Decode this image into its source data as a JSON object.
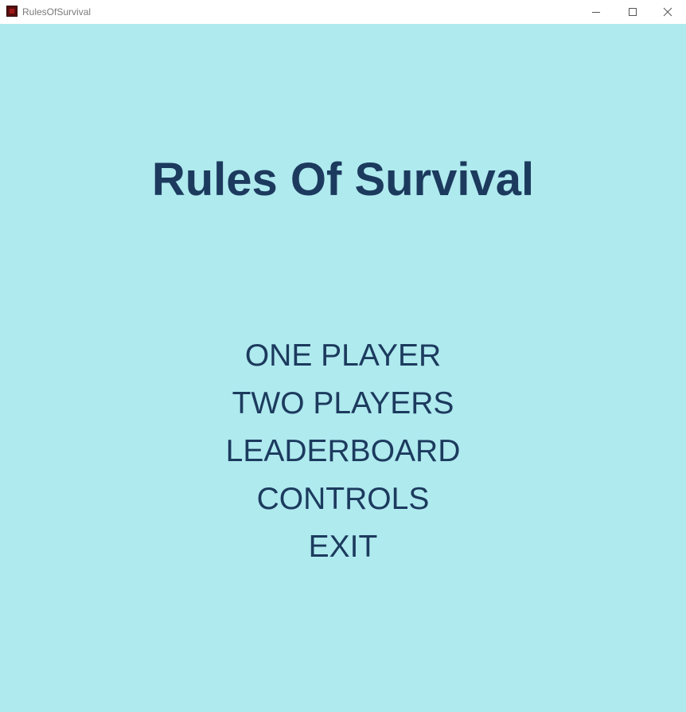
{
  "window": {
    "title": "RulesOfSurvival",
    "icon": "app-icon",
    "controls": [
      "minimize-icon",
      "maximize-icon",
      "close-icon"
    ]
  },
  "game": {
    "title": "Rules Of Survival",
    "background_color": "#afeaee",
    "text_color": "#1c3a5e"
  },
  "menu": {
    "items": [
      {
        "label": "ONE PLAYER"
      },
      {
        "label": "TWO PLAYERS"
      },
      {
        "label": "LEADERBOARD"
      },
      {
        "label": "CONTROLS"
      },
      {
        "label": "EXIT"
      }
    ]
  }
}
